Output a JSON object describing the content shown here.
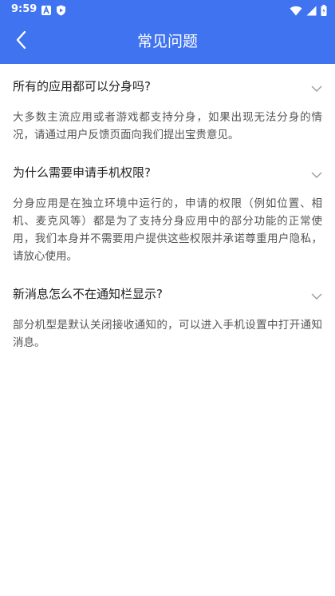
{
  "status_bar": {
    "time": "9:59",
    "icons_left": [
      "a-letter-icon",
      "shield-play-icon"
    ],
    "icons_right": [
      "wifi-icon",
      "signal-icon",
      "battery-icon"
    ]
  },
  "app_bar": {
    "title": "常见问题",
    "back_icon": "chevron-left-icon",
    "color": "#3f73f0"
  },
  "faqs": [
    {
      "question": "所有的应用都可以分身吗?",
      "answer": "大多数主流应用或者游戏都支持分身，如果出现无法分身的情况，请通过用户反馈页面向我们提出宝贵意见。",
      "icon": "chevron-down-icon"
    },
    {
      "question": "为什么需要申请手机权限?",
      "answer": "分身应用是在独立环境中运行的，申请的权限（例如位置、相机、麦克风等）都是为了支持分身应用中的部分功能的正常使用，我们本身并不需要用户提供这些权限并承诺尊重用户隐私，请放心使用。",
      "icon": "chevron-down-icon"
    },
    {
      "question": "新消息怎么不在通知栏显示?",
      "answer": "部分机型是默认关闭接收通知的，可以进入手机设置中打开通知消息。",
      "icon": "chevron-down-icon"
    }
  ]
}
